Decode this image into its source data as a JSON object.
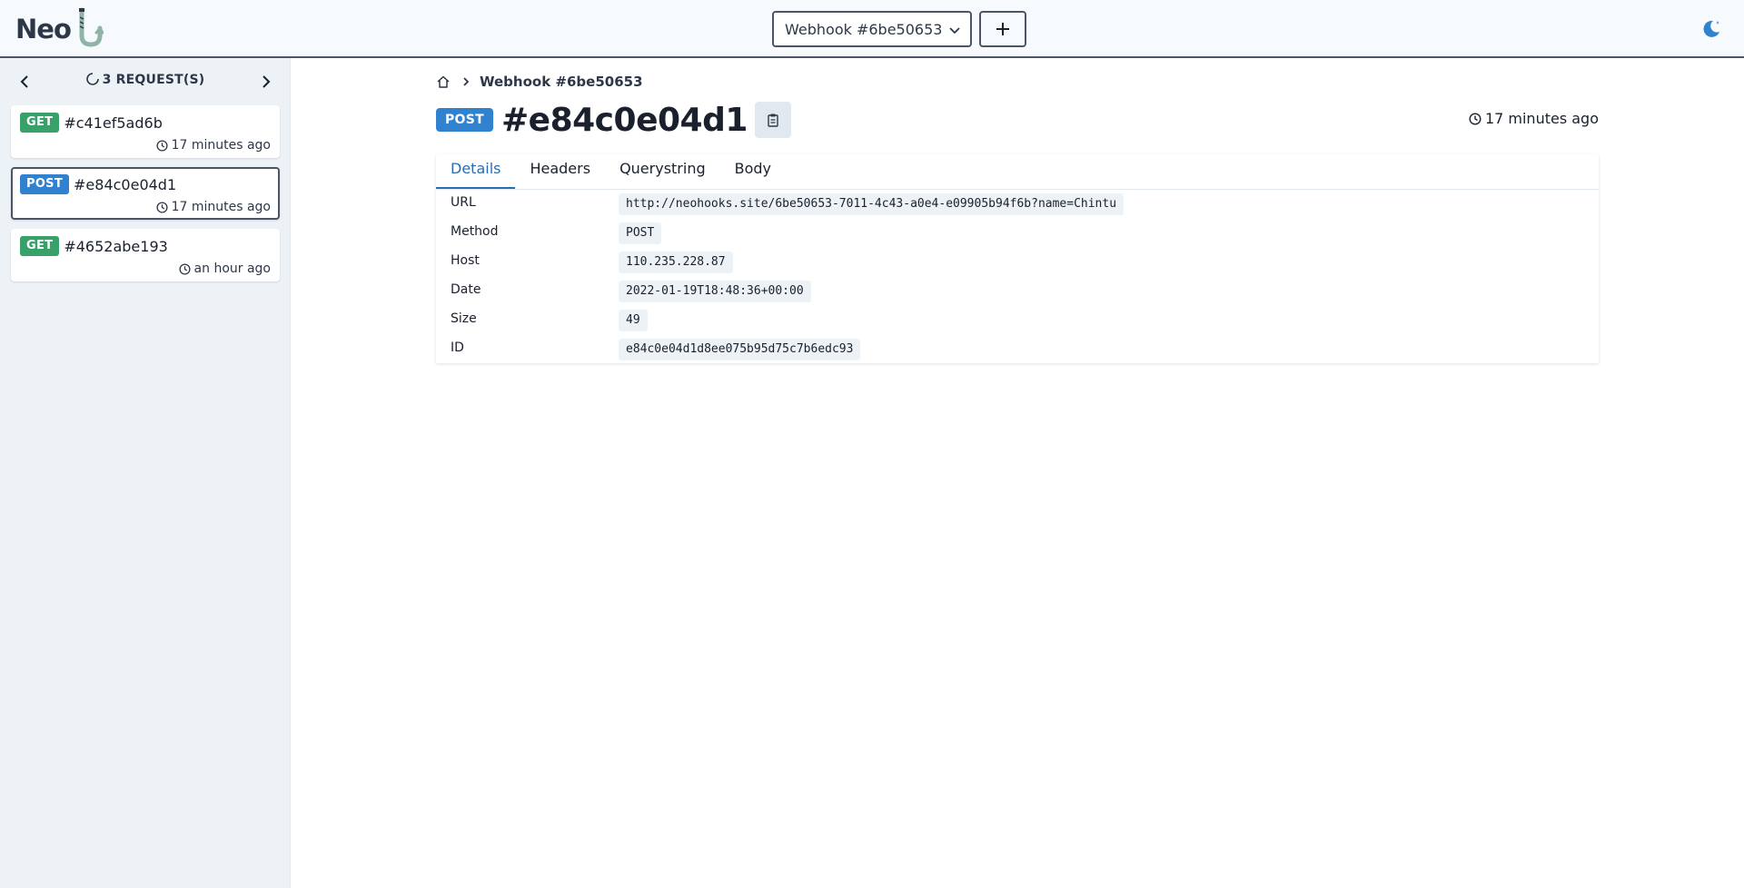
{
  "app": {
    "name": "Neo"
  },
  "header": {
    "webhook_select": {
      "value": "Webhook #6be50653"
    },
    "add_button_icon": "plus-icon",
    "theme_toggle_icon": "moon-icon"
  },
  "sidebar": {
    "count_label": "3 REQUEST(S)",
    "requests": [
      {
        "method": "GET",
        "id": "#c41ef5ad6b",
        "time": "17 minutes ago",
        "active": false
      },
      {
        "method": "POST",
        "id": "#e84c0e04d1",
        "time": "17 minutes ago",
        "active": true
      },
      {
        "method": "GET",
        "id": "#4652abe193",
        "time": "an hour ago",
        "active": false
      }
    ]
  },
  "breadcrumb": {
    "home_icon": "home-icon",
    "current": "Webhook #6be50653"
  },
  "request": {
    "method": "POST",
    "id": "#e84c0e04d1",
    "time": "17 minutes ago"
  },
  "tabs": [
    "Details",
    "Headers",
    "Querystring",
    "Body"
  ],
  "active_tab": "Details",
  "details": [
    {
      "label": "URL",
      "value": "http://neohooks.site/6be50653-7011-4c43-a0e4-e09905b94f6b?name=Chintu"
    },
    {
      "label": "Method",
      "value": "POST"
    },
    {
      "label": "Host",
      "value": "110.235.228.87"
    },
    {
      "label": "Date",
      "value": "2022-01-19T18:48:36+00:00"
    },
    {
      "label": "Size",
      "value": "49"
    },
    {
      "label": "ID",
      "value": "e84c0e04d1d8ee075b95d75c7b6edc93"
    }
  ],
  "colors": {
    "get": "#38a169",
    "post": "#3182ce",
    "accent": "#2b6cb0"
  }
}
